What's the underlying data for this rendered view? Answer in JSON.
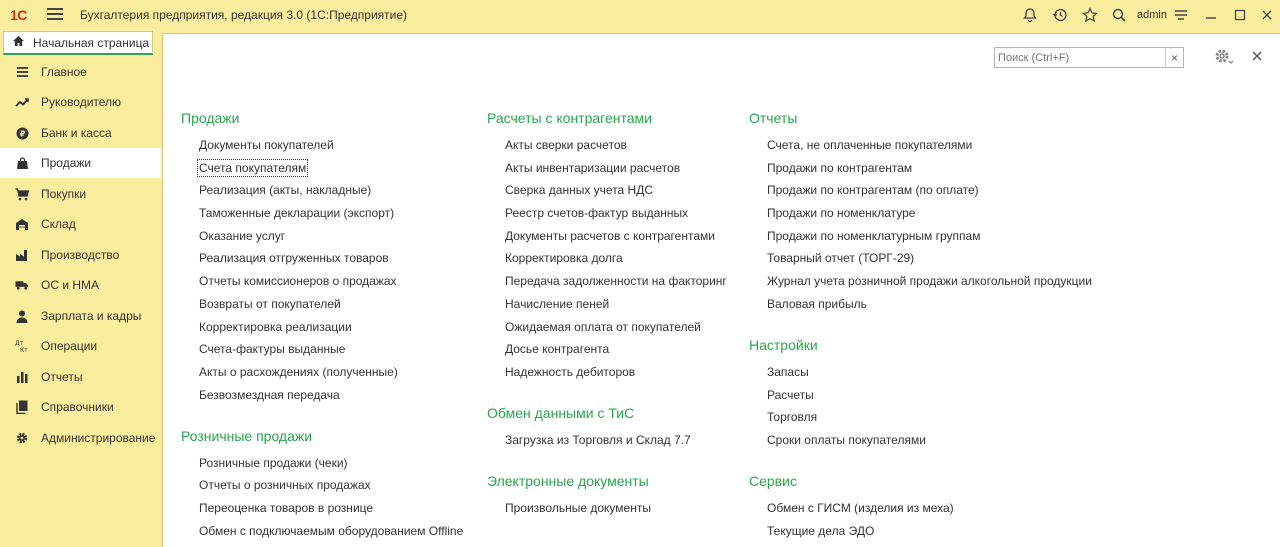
{
  "titlebar": {
    "logo": "1С",
    "title": "Бухгалтерия предприятия, редакция 3.0  (1С:Предприятие)",
    "user": "admin"
  },
  "home_tab": {
    "label": "Начальная страница"
  },
  "sidebar": {
    "items": [
      {
        "label": "Главное",
        "icon": "list-icon"
      },
      {
        "label": "Руководителю",
        "icon": "trend-icon"
      },
      {
        "label": "Банк и касса",
        "icon": "coin-icon"
      },
      {
        "label": "Продажи",
        "icon": "bag-icon"
      },
      {
        "label": "Покупки",
        "icon": "cart-icon"
      },
      {
        "label": "Склад",
        "icon": "warehouse-icon"
      },
      {
        "label": "Производство",
        "icon": "factory-icon"
      },
      {
        "label": "ОС и НМА",
        "icon": "truck-icon"
      },
      {
        "label": "Зарплата и кадры",
        "icon": "person-icon"
      },
      {
        "label": "Операции",
        "icon": "dt-kt-icon"
      },
      {
        "label": "Отчеты",
        "icon": "bar-chart-icon"
      },
      {
        "label": "Справочники",
        "icon": "books-icon"
      },
      {
        "label": "Администрирование",
        "icon": "gear-icon"
      }
    ],
    "active_index": 3
  },
  "search": {
    "placeholder": "Поиск (Ctrl+F)",
    "clear": "×"
  },
  "dt_kt": {
    "dt": "Дт",
    "kt": "Кт"
  },
  "columns": [
    {
      "groups": [
        {
          "title": "Продажи",
          "links": [
            "Документы покупателей",
            "Счета покупателям",
            "Реализация (акты, накладные)",
            "Таможенные декларации (экспорт)",
            "Оказание услуг",
            "Реализация отгруженных товаров",
            "Отчеты комиссионеров о продажах",
            "Возвраты от покупателей",
            "Корректировка реализации",
            "Счета-фактуры выданные",
            "Акты о расхождениях (полученные)",
            "Безвозмездная передача"
          ]
        },
        {
          "title": "Розничные продажи",
          "links": [
            "Розничные продажи (чеки)",
            "Отчеты о розничных продажах",
            "Переоценка товаров в рознице",
            "Обмен с подключаемым оборудованием Offline"
          ]
        }
      ]
    },
    {
      "groups": [
        {
          "title": "Расчеты с контрагентами",
          "links": [
            "Акты сверки расчетов",
            "Акты инвентаризации расчетов",
            "Сверка данных учета НДС",
            "Реестр счетов-фактур выданных",
            "Документы расчетов с контрагентами",
            "Корректировка долга",
            "Передача задолженности на факторинг",
            "Начисление пеней",
            "Ожидаемая оплата от покупателей",
            "Досье контрагента",
            "Надежность дебиторов"
          ]
        },
        {
          "title": "Обмен данными с ТиС",
          "links": [
            "Загрузка из Торговля и Склад 7.7"
          ]
        },
        {
          "title": "Электронные документы",
          "links": [
            "Произвольные документы"
          ]
        }
      ]
    },
    {
      "groups": [
        {
          "title": "Отчеты",
          "links": [
            "Счета, не оплаченные покупателями",
            "Продажи по контрагентам",
            "Продажи по контрагентам (по оплате)",
            "Продажи по номенклатуре",
            "Продажи по номенклатурным группам",
            "Товарный отчет (ТОРГ-29)",
            "Журнал учета розничной продажи алкогольной продукции",
            "Валовая прибыль"
          ]
        },
        {
          "title": "Настройки",
          "links": [
            "Запасы",
            "Расчеты",
            "Торговля",
            "Сроки оплаты покупателями"
          ]
        },
        {
          "title": "Сервис",
          "links": [
            "Обмен с ГИСМ (изделия из меха)",
            "Текущие дела ЭДО"
          ]
        }
      ]
    }
  ]
}
